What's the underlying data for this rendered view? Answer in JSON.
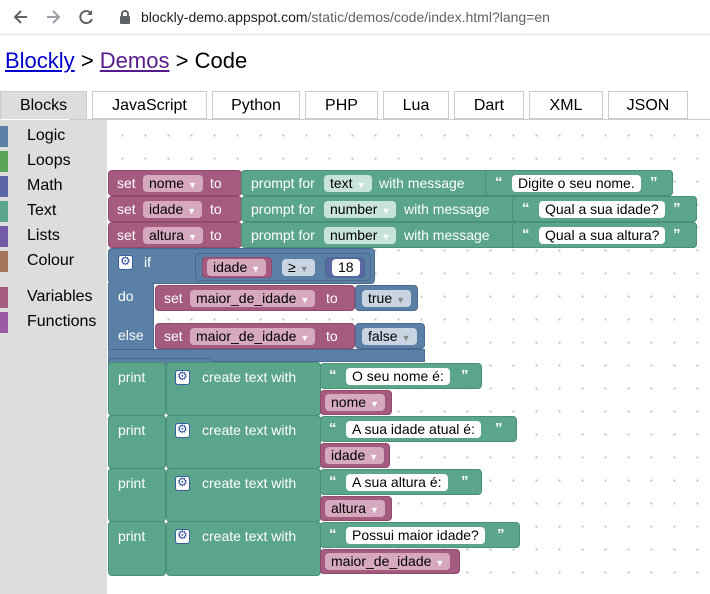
{
  "browser": {
    "url_host": "blockly-demo.appspot.com",
    "url_path": "/static/demos/code/index.html?lang=en",
    "back_icon": "back-arrow-icon",
    "forward_icon": "forward-arrow-icon",
    "reload_icon": "reload-icon",
    "lock_icon": "lock-icon"
  },
  "header": {
    "link1": "Blockly",
    "sep1": ">",
    "link2": "Demos",
    "sep2": ">",
    "current": "Code"
  },
  "tabs": [
    "Blocks",
    "JavaScript",
    "Python",
    "PHP",
    "Lua",
    "Dart",
    "XML",
    "JSON"
  ],
  "toolbox": {
    "categories": [
      {
        "label": "Logic",
        "color": "#5b80a5"
      },
      {
        "label": "Loops",
        "color": "#5ba55b"
      },
      {
        "label": "Math",
        "color": "#5b67a5"
      },
      {
        "label": "Text",
        "color": "#5ba58c"
      },
      {
        "label": "Lists",
        "color": "#745ba5"
      },
      {
        "label": "Colour",
        "color": "#a5745b"
      },
      {
        "label": "Variables",
        "color": "#a55b80"
      },
      {
        "label": "Functions",
        "color": "#995ba5"
      }
    ]
  },
  "blocks": {
    "set_kw": "set",
    "to_kw": "to",
    "prompt_for": "prompt for",
    "with_message": "with message",
    "open_quote": "“",
    "close_quote": "”",
    "if_kw": "if",
    "do_kw": "do",
    "else_kw": "else",
    "print_kw": "print",
    "create_text_with": "create text with",
    "row1": {
      "var": "nome",
      "type": "text",
      "message": "Digite o seu nome."
    },
    "row2": {
      "var": "idade",
      "type": "number",
      "message": "Qual a sua idade?"
    },
    "row3": {
      "var": "altura",
      "type": "number",
      "message": "Qual a sua altura?"
    },
    "if_cond": {
      "var": "idade",
      "op": "≥",
      "value": "18"
    },
    "do_set": {
      "var": "maior_de_idade",
      "value": "true"
    },
    "else_set": {
      "var": "maior_de_idade",
      "value": "false"
    },
    "prints": [
      {
        "text": "O seu nome é:",
        "var": "nome"
      },
      {
        "text": "A sua idade atual é:",
        "var": "idade"
      },
      {
        "text": "A sua altura é:",
        "var": "altura"
      },
      {
        "text": "Possui maior idade?",
        "var": "maior_de_idade"
      }
    ]
  },
  "colors": {
    "variables": "#a55b80",
    "text": "#5ba58c",
    "logic": "#5b80a5",
    "link": "#0000cc",
    "visited_link": "#551a8b"
  }
}
